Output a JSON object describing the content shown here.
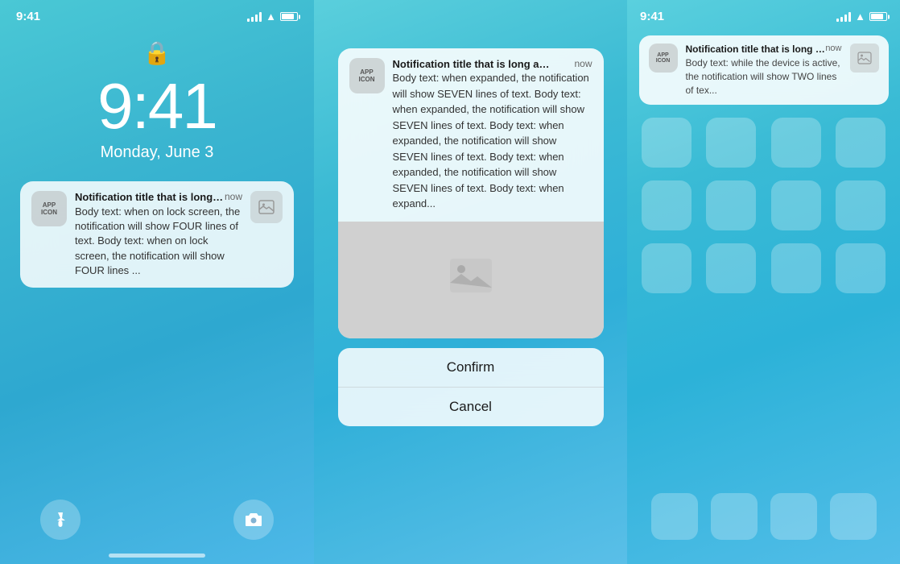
{
  "leftPanel": {
    "statusBar": {
      "time": "9:41"
    },
    "lock": "🔒",
    "clockTime": "9:41",
    "date": "Monday, June 3",
    "notification": {
      "appIconLine1": "APP",
      "appIconLine2": "ICON",
      "title": "Notification title that is long and trun...",
      "time": "now",
      "body": "Body text: when on lock screen, the notification will show FOUR lines of text. Body text: when on lock screen, the notification will show FOUR lines ...",
      "hasImage": true
    },
    "bottomIcons": {
      "left": "🔦",
      "right": "📷"
    }
  },
  "middlePanel": {
    "notification": {
      "appIconLine1": "APP",
      "appIconLine2": "ICON",
      "title": "Notification title that is long and trun...",
      "time": "now",
      "body": "Body text: when expanded, the notification will show SEVEN lines of text. Body text: when expanded, the notification will show SEVEN lines of text. Body text: when expanded, the notification will show SEVEN lines of text. Body text: when expanded, the notification will show SEVEN lines of text. Body text: when expand...",
      "hasImage": true
    },
    "actions": {
      "confirm": "Confirm",
      "cancel": "Cancel"
    }
  },
  "rightPanel": {
    "notification": {
      "appIconLine1": "APP",
      "appIconLine2": "ICON",
      "title": "Notification title that is long and trun...",
      "time": "now",
      "body": "Body text: while the device is active, the notification will show TWO lines of tex...",
      "hasImage": true
    }
  }
}
